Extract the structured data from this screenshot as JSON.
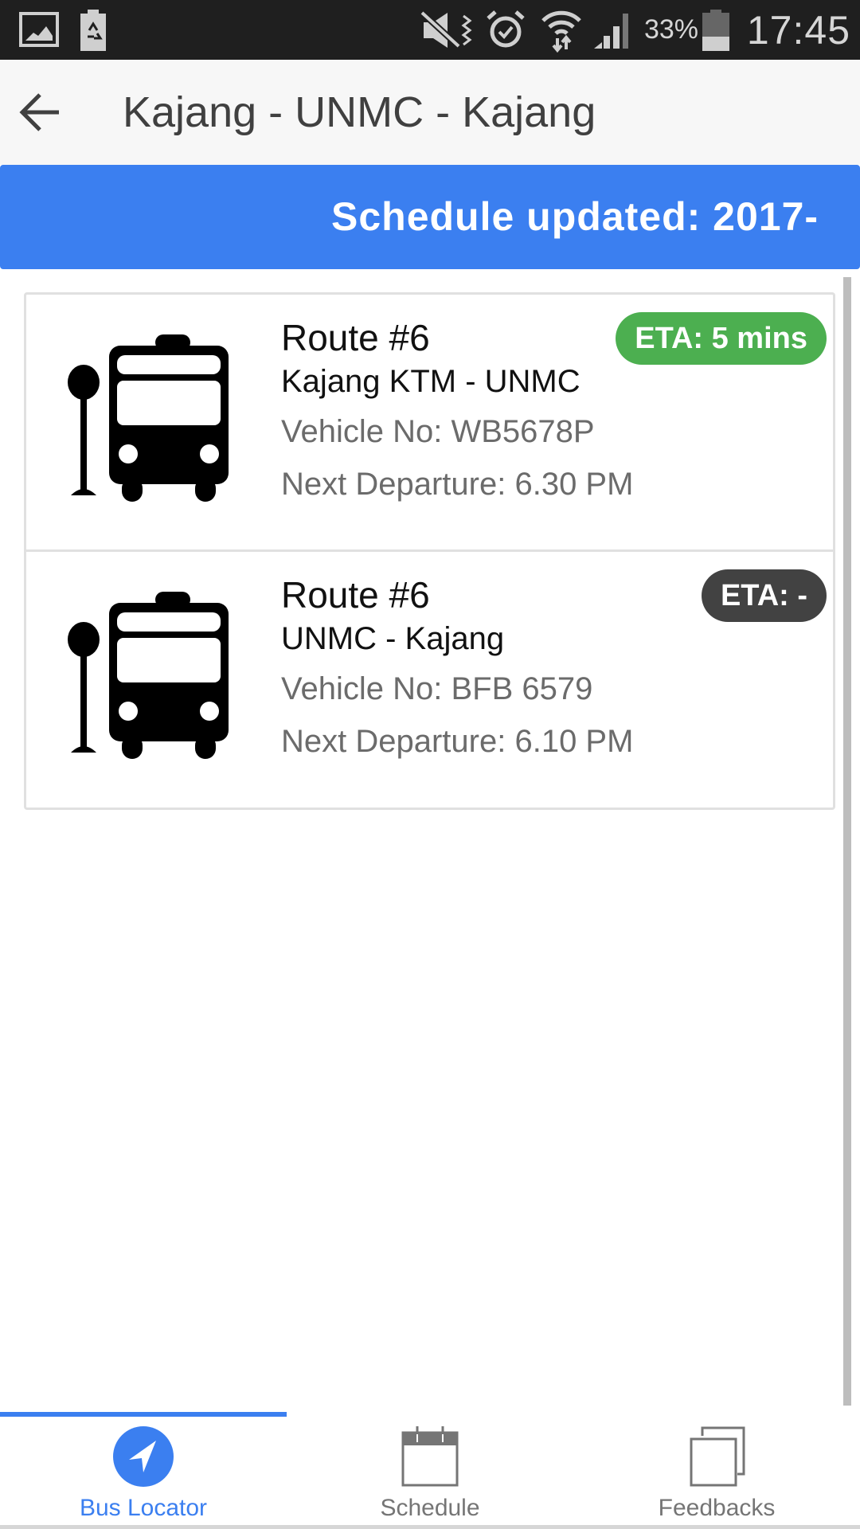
{
  "status_bar": {
    "icons": [
      "image-notification-icon",
      "battery-saver-icon",
      "mute-vibrate-icon",
      "alarm-icon",
      "wifi-icon",
      "signal-icon",
      "battery-icon"
    ],
    "battery_percent": "33%",
    "time": "17:45"
  },
  "app_bar": {
    "back_icon": "arrow-left-icon",
    "title": "Kajang - UNMC - Kajang"
  },
  "banner": {
    "text": "Schedule updated: 2017-"
  },
  "routes": [
    {
      "icon": "bus-stop-icon",
      "route": "Route #6",
      "path": "Kajang KTM - UNMC",
      "vehicle": "Vehicle No: WB5678P",
      "departure": "Next Departure: 6.30 PM",
      "eta": "ETA: 5 mins",
      "eta_color": "#4caf50"
    },
    {
      "icon": "bus-stop-icon",
      "route": "Route #6",
      "path": "UNMC - Kajang",
      "vehicle": "Vehicle No: BFB 6579",
      "departure": "Next Departure: 6.10 PM",
      "eta": "ETA: -",
      "eta_color": "#424242"
    }
  ],
  "bottom_nav": {
    "tabs": [
      {
        "label": "Bus Locator",
        "icon": "navigation-icon",
        "active": true
      },
      {
        "label": "Schedule",
        "icon": "calendar-icon",
        "active": false
      },
      {
        "label": "Feedbacks",
        "icon": "copy-icon",
        "active": false
      }
    ]
  },
  "colors": {
    "accent": "#3b7ff0",
    "eta_available": "#4caf50",
    "eta_unavailable": "#424242",
    "status_bar": "#1f1f1f"
  }
}
